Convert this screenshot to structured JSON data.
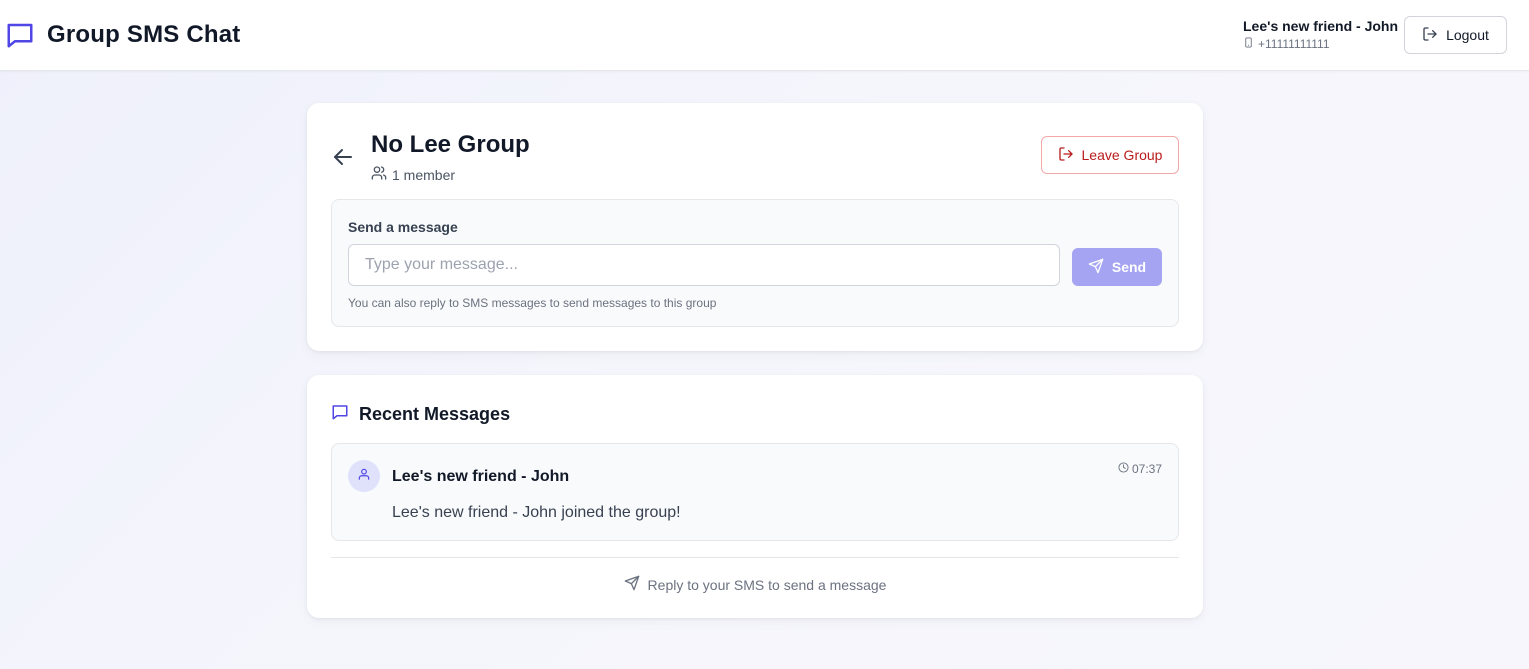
{
  "app": {
    "title": "Group SMS Chat",
    "accent_color": "#4f46e5",
    "brand_icon": "message-square-icon"
  },
  "user": {
    "name": "Lee's new friend - John",
    "phone": "+11111111111",
    "phone_icon": "smartphone-icon"
  },
  "header": {
    "logout_label": "Logout",
    "logout_icon": "log-out-icon"
  },
  "group": {
    "name": "No Lee Group",
    "member_count_label": "1 member",
    "back_icon": "arrow-left-icon",
    "members_icon": "users-icon",
    "leave_label": "Leave Group",
    "leave_icon": "log-out-icon",
    "leave_color": "#b91c1c"
  },
  "composer": {
    "label": "Send a message",
    "placeholder": "Type your message...",
    "value": "",
    "send_label": "Send",
    "send_icon": "send-icon",
    "send_color": "#a5a4f3",
    "hint": "You can also reply to SMS messages to send messages to this group"
  },
  "recent": {
    "title": "Recent Messages",
    "icon": "message-square-icon",
    "messages": [
      {
        "sender": "Lee's new friend - John",
        "time": "07:37",
        "text": "Lee's new friend - John joined the group!",
        "avatar_icon": "user-icon",
        "time_icon": "clock-icon"
      }
    ],
    "reply_hint": "Reply to your SMS to send a message",
    "reply_icon": "send-icon"
  }
}
